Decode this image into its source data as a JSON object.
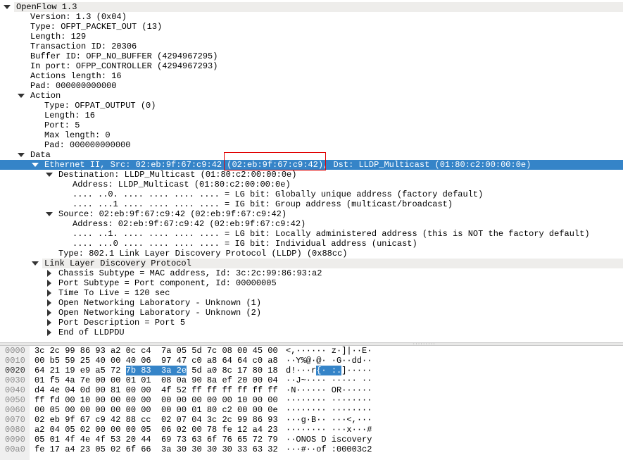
{
  "details": {
    "rows": [
      {
        "level": 0,
        "exp": "open",
        "text": "OpenFlow 1.3",
        "style": "shaded"
      },
      {
        "level": 1,
        "exp": "none",
        "text": "Version: 1.3 (0x04)"
      },
      {
        "level": 1,
        "exp": "none",
        "text": "Type: OFPT_PACKET_OUT (13)"
      },
      {
        "level": 1,
        "exp": "none",
        "text": "Length: 129"
      },
      {
        "level": 1,
        "exp": "none",
        "text": "Transaction ID: 20306"
      },
      {
        "level": 1,
        "exp": "none",
        "text": "Buffer ID: OFP_NO_BUFFER (4294967295)"
      },
      {
        "level": 1,
        "exp": "none",
        "text": "In port: OFPP_CONTROLLER (4294967293)"
      },
      {
        "level": 1,
        "exp": "none",
        "text": "Actions length: 16"
      },
      {
        "level": 1,
        "exp": "none",
        "text": "Pad: 000000000000"
      },
      {
        "level": 1,
        "exp": "open",
        "text": "Action"
      },
      {
        "level": 2,
        "exp": "none",
        "text": "Type: OFPAT_OUTPUT (0)"
      },
      {
        "level": 2,
        "exp": "none",
        "text": "Length: 16"
      },
      {
        "level": 2,
        "exp": "none",
        "text": "Port: 5"
      },
      {
        "level": 2,
        "exp": "none",
        "text": "Max length: 0"
      },
      {
        "level": 2,
        "exp": "none",
        "text": "Pad: 000000000000"
      },
      {
        "level": 1,
        "exp": "open",
        "text": "Data"
      },
      {
        "level": 2,
        "exp": "open",
        "text": "Ethernet II, Src: 02:eb:9f:67:c9:42 (02:eb:9f:67:c9:42), Dst: LLDP_Multicast (01:80:c2:00:00:0e)",
        "style": "selected"
      },
      {
        "level": 3,
        "exp": "open",
        "text": "Destination: LLDP_Multicast (01:80:c2:00:00:0e)"
      },
      {
        "level": 4,
        "exp": "none",
        "text": "Address: LLDP_Multicast (01:80:c2:00:00:0e)"
      },
      {
        "level": 4,
        "exp": "none",
        "text": ".... ..0. .... .... .... .... = LG bit: Globally unique address (factory default)"
      },
      {
        "level": 4,
        "exp": "none",
        "text": ".... ...1 .... .... .... .... = IG bit: Group address (multicast/broadcast)"
      },
      {
        "level": 3,
        "exp": "open",
        "text": "Source: 02:eb:9f:67:c9:42 (02:eb:9f:67:c9:42)"
      },
      {
        "level": 4,
        "exp": "none",
        "text": "Address: 02:eb:9f:67:c9:42 (02:eb:9f:67:c9:42)"
      },
      {
        "level": 4,
        "exp": "none",
        "text": ".... ..1. .... .... .... .... = LG bit: Locally administered address (this is NOT the factory default)"
      },
      {
        "level": 4,
        "exp": "none",
        "text": ".... ...0 .... .... .... .... = IG bit: Individual address (unicast)"
      },
      {
        "level": 3,
        "exp": "none",
        "text": "Type: 802.1 Link Layer Discovery Protocol (LLDP) (0x88cc)"
      },
      {
        "level": 2,
        "exp": "open",
        "text": "Link Layer Discovery Protocol",
        "style": "shaded"
      },
      {
        "level": 3,
        "exp": "closed",
        "text": "Chassis Subtype = MAC address, Id: 3c:2c:99:86:93:a2"
      },
      {
        "level": 3,
        "exp": "closed",
        "text": "Port Subtype = Port component, Id: 00000005"
      },
      {
        "level": 3,
        "exp": "closed",
        "text": "Time To Live = 120 sec"
      },
      {
        "level": 3,
        "exp": "closed",
        "text": "Open Networking Laboratory - Unknown (1)"
      },
      {
        "level": 3,
        "exp": "closed",
        "text": "Open Networking Laboratory - Unknown (2)"
      },
      {
        "level": 3,
        "exp": "closed",
        "text": "Port Description = Port 5"
      },
      {
        "level": 3,
        "exp": "closed",
        "text": "End of LLDPDU"
      }
    ]
  },
  "hex": {
    "rows": [
      {
        "offset": "0000",
        "bytes": [
          "3c 2c 99 86 93 a2 0c c4  7a 05 5d 7c 08 00 45 00"
        ],
        "ascii": [
          "<,······ z·]|··E·"
        ]
      },
      {
        "offset": "0010",
        "bytes": [
          "00 b5 59 25 40 00 40 06  97 47 c0 a8 64 64 c0 a8"
        ],
        "ascii": [
          "··Y%@·@· ·G··dd··"
        ]
      },
      {
        "offset": "0020",
        "current": true,
        "bytes": [
          "64 21 19 e9 a5 72 ",
          "7b 83  3a 2e",
          " 5d a0 8c 17 80 18"
        ],
        "ascii": [
          "d!···r",
          "{· :.",
          "]·····"
        ]
      },
      {
        "offset": "0030",
        "bytes": [
          "01 f5 4a 7e 00 00 01 01  08 0a 90 8a ef 20 00 04"
        ],
        "ascii": [
          "··J~···· ····· ··"
        ]
      },
      {
        "offset": "0040",
        "bytes": [
          "d4 4e 04 0d 00 81 00 00  4f 52 ff ff ff ff ff ff"
        ],
        "ascii": [
          "·N······ OR······"
        ]
      },
      {
        "offset": "0050",
        "bytes": [
          "ff fd 00 10 00 00 00 00  00 00 00 00 00 10 00 00"
        ],
        "ascii": [
          "········ ········"
        ]
      },
      {
        "offset": "0060",
        "bytes": [
          "00 05 00 00 00 00 00 00  00 00 01 80 c2 00 00 0e"
        ],
        "ascii": [
          "········ ········"
        ]
      },
      {
        "offset": "0070",
        "bytes": [
          "02 eb 9f 67 c9 42 88 cc  02 07 04 3c 2c 99 86 93"
        ],
        "ascii": [
          "···g·B·· ···<,···"
        ]
      },
      {
        "offset": "0080",
        "bytes": [
          "a2 04 05 02 00 00 00 05  06 02 00 78 fe 12 a4 23"
        ],
        "ascii": [
          "········ ···x···#"
        ]
      },
      {
        "offset": "0090",
        "bytes": [
          "05 01 4f 4e 4f 53 20 44  69 73 63 6f 76 65 72 79"
        ],
        "ascii": [
          "··ONOS D iscovery"
        ]
      },
      {
        "offset": "00a0",
        "bytes": [
          "fe 17 a4 23 05 02 6f 66  3a 30 30 30 30 33 63 32"
        ],
        "ascii": [
          "···#··of :00003c2"
        ]
      }
    ]
  },
  "colors": {
    "selection": "#3584c8",
    "annotation_box": "#e00000",
    "shaded_row": "#eeedeb"
  }
}
